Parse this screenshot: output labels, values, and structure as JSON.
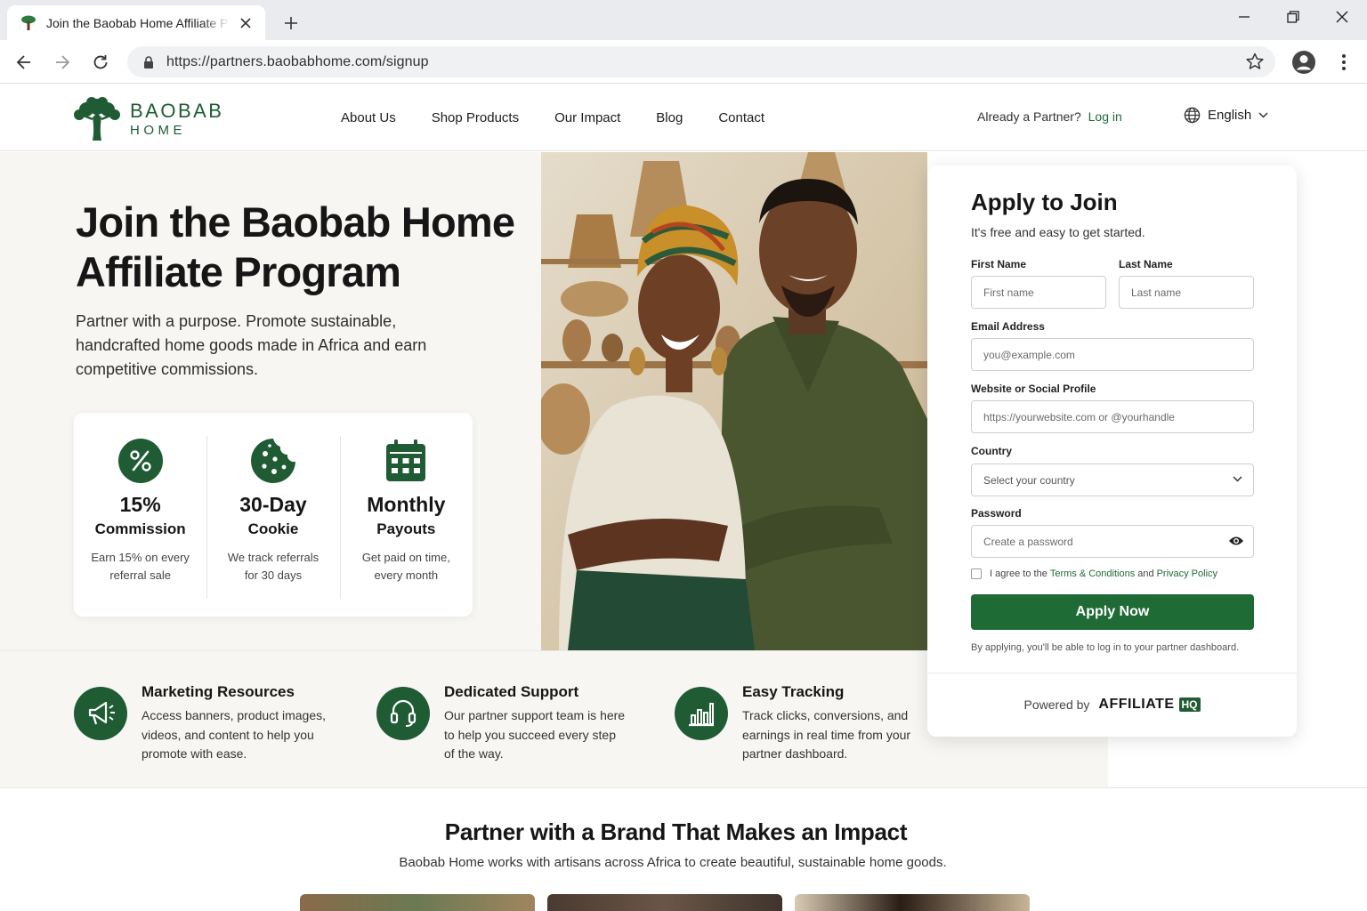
{
  "browser": {
    "tab_title": "Join the Baobab Home Affiliate Program",
    "url": "https://partners.baobabhome.com/signup"
  },
  "header": {
    "logo_word1": "BAOBAB",
    "logo_word2": "HOME",
    "nav": [
      "About Us",
      "Shop Products",
      "Our Impact",
      "Blog",
      "Contact"
    ],
    "already_text": "Already a Partner?",
    "login_label": "Log in",
    "language": "English"
  },
  "hero": {
    "title": "Join the Baobab Home Affiliate Program",
    "subtitle": "Partner with a purpose. Promote sustainable, handcrafted home goods made in Africa and earn competitive commissions.",
    "benefits": [
      {
        "value": "15%",
        "label": "Commission",
        "desc": "Earn 15% on every referral sale",
        "icon": "percent-icon"
      },
      {
        "value": "30-Day",
        "label": "Cookie",
        "desc": "We track referrals for 30 days",
        "icon": "cookie-icon"
      },
      {
        "value": "Monthly",
        "label": "Payouts",
        "desc": "Get paid on time, every month",
        "icon": "calendar-icon"
      }
    ]
  },
  "features": [
    {
      "title": "Marketing Resources",
      "desc": "Access banners, product images, videos, and content to help you promote with ease.",
      "icon": "megaphone-icon"
    },
    {
      "title": "Dedicated Support",
      "desc": "Our partner support team is here to help you succeed every step of the way.",
      "icon": "headset-icon"
    },
    {
      "title": "Easy Tracking",
      "desc": "Track clicks, conversions, and earnings in real time from your partner dashboard.",
      "icon": "bar-chart-icon"
    }
  ],
  "form": {
    "title": "Apply to Join",
    "subtitle": "It's free and easy to get started.",
    "first_name_label": "First Name",
    "first_name_placeholder": "First name",
    "last_name_label": "Last Name",
    "last_name_placeholder": "Last name",
    "email_label": "Email Address",
    "email_placeholder": "you@example.com",
    "website_label": "Website or Social Profile",
    "website_placeholder": "https://yourwebsite.com or @yourhandle",
    "country_label": "Country",
    "country_value": "Select your country",
    "password_label": "Password",
    "password_placeholder": "Create a password",
    "agree_prefix": "I agree to the",
    "terms_label": "Terms & Conditions",
    "agree_and": "and",
    "privacy_label": "Privacy Policy",
    "submit_label": "Apply Now",
    "note": "By applying, you'll be able to log in to your partner dashboard.",
    "powered_by": "Powered by",
    "powered_brand": "AFFILIATE",
    "powered_badge": "HQ"
  },
  "impact": {
    "title": "Partner with a Brand That Makes an Impact",
    "subtitle": "Baobab Home works with artisans across Africa to create beautiful, sustainable home goods."
  },
  "colors": {
    "brand_green": "#1f5c34",
    "button_green": "#1f6b36",
    "hero_bg": "#f7f6f3"
  }
}
